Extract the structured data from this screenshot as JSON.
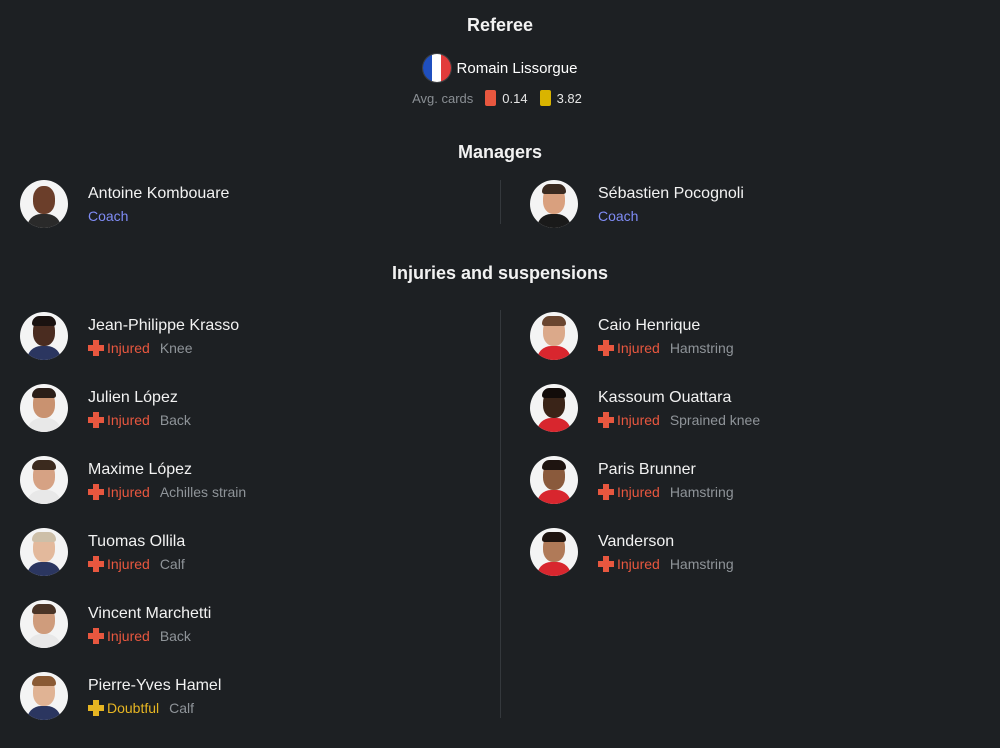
{
  "referee": {
    "title": "Referee",
    "name": "Romain Lissorgue",
    "flag_icon": "france-flag-icon",
    "avg_cards_label": "Avg. cards",
    "red_avg": "0.14",
    "yellow_avg": "3.82",
    "red_color": "#e8573f",
    "yellow_color": "#d9b400"
  },
  "managers": {
    "title": "Managers",
    "left": {
      "name": "Antoine Kombouare",
      "role": "Coach"
    },
    "right": {
      "name": "Sébastien Pocognoli",
      "role": "Coach"
    }
  },
  "injuries": {
    "title": "Injuries and suspensions",
    "left": [
      {
        "name": "Jean-Philippe Krasso",
        "status": "Injured",
        "reason": "Knee"
      },
      {
        "name": "Julien López",
        "status": "Injured",
        "reason": "Back"
      },
      {
        "name": "Maxime López",
        "status": "Injured",
        "reason": "Achilles strain"
      },
      {
        "name": "Tuomas Ollila",
        "status": "Injured",
        "reason": "Calf"
      },
      {
        "name": "Vincent Marchetti",
        "status": "Injured",
        "reason": "Back"
      },
      {
        "name": "Pierre-Yves Hamel",
        "status": "Doubtful",
        "reason": "Calf"
      }
    ],
    "right": [
      {
        "name": "Caio Henrique",
        "status": "Injured",
        "reason": "Hamstring"
      },
      {
        "name": "Kassoum Ouattara",
        "status": "Injured",
        "reason": "Sprained knee"
      },
      {
        "name": "Paris Brunner",
        "status": "Injured",
        "reason": "Hamstring"
      },
      {
        "name": "Vanderson",
        "status": "Injured",
        "reason": "Hamstring"
      }
    ]
  },
  "colors": {
    "injured": "#e8573f",
    "doubtful": "#e6b522",
    "coach": "#7f8cf5",
    "background": "#1d2023"
  }
}
